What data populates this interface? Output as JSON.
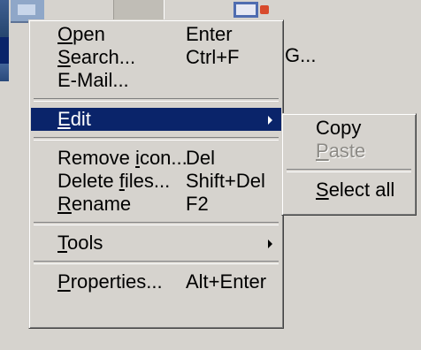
{
  "background": {
    "filename_fragment": "G..."
  },
  "context_menu": {
    "groups": [
      [
        {
          "name": "open",
          "mnemonic": "O",
          "rest": "pen",
          "shortcut": "Enter"
        },
        {
          "name": "search",
          "mnemonic": "S",
          "rest": "earch...",
          "shortcut": "Ctrl+F"
        },
        {
          "name": "email",
          "mnemonic": "",
          "rest": "E-Mail...",
          "shortcut": ""
        }
      ],
      [
        {
          "name": "edit",
          "mnemonic": "E",
          "rest": "dit",
          "shortcut": "",
          "submenu": true,
          "highlighted": true
        }
      ],
      [
        {
          "name": "remove-icon",
          "pre": "Remove ",
          "mnemonic": "i",
          "rest": "con...",
          "shortcut": "Del"
        },
        {
          "name": "delete-files",
          "pre": "Delete ",
          "mnemonic": "f",
          "rest": "iles...",
          "shortcut": "Shift+Del"
        },
        {
          "name": "rename",
          "mnemonic": "R",
          "rest": "ename",
          "shortcut": "F2"
        }
      ],
      [
        {
          "name": "tools",
          "mnemonic": "T",
          "rest": "ools",
          "shortcut": "",
          "submenu": true
        }
      ],
      [
        {
          "name": "properties",
          "mnemonic": "P",
          "rest": "roperties...",
          "shortcut": "Alt+Enter"
        }
      ]
    ]
  },
  "edit_submenu": {
    "groups": [
      [
        {
          "name": "copy",
          "mnemonic": "",
          "rest": "Copy"
        },
        {
          "name": "paste",
          "mnemonic": "P",
          "rest": "aste",
          "disabled": true
        }
      ],
      [
        {
          "name": "select-all",
          "mnemonic": "S",
          "rest": "elect all"
        }
      ]
    ]
  },
  "colors": {
    "menu_face": "#d6d3ce",
    "highlight": "#0a246a",
    "highlight_text": "#ffffff",
    "disabled_text": "#8c8a85"
  }
}
